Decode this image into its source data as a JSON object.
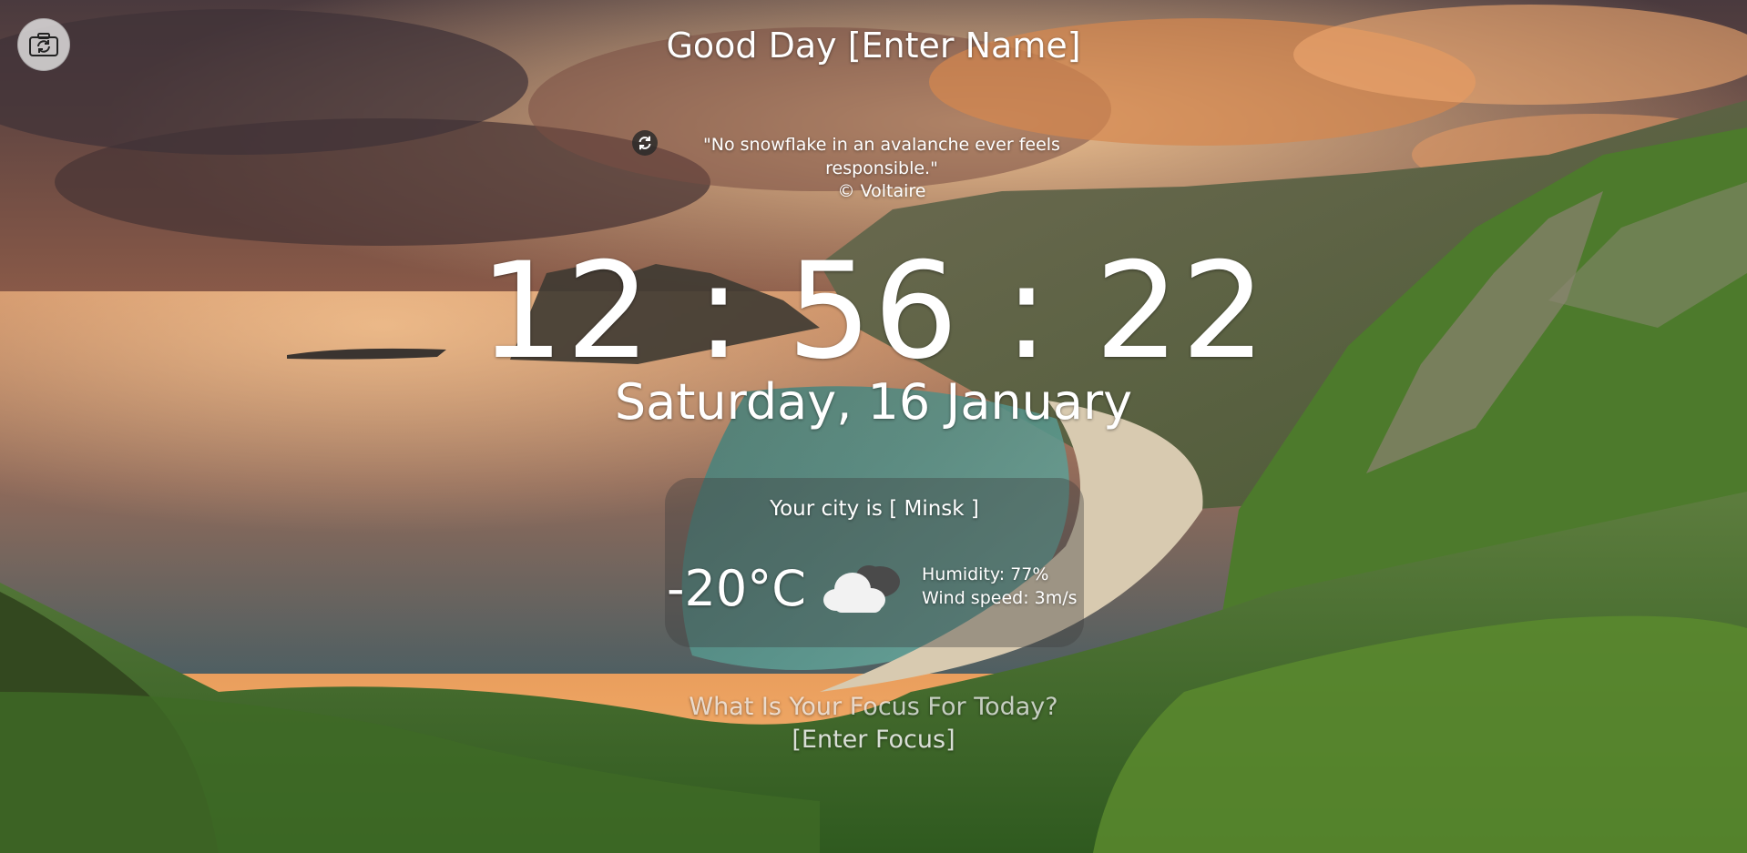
{
  "greeting": {
    "prefix": "Good Day",
    "name": "[Enter Name]"
  },
  "background_button": {
    "icon": "refresh-image-icon"
  },
  "quote": {
    "refresh_icon": "refresh-icon",
    "text": "\"No snowflake in an avalanche ever feels responsible.\"",
    "author": "© Voltaire"
  },
  "clock": {
    "time": "12 : 56 : 22"
  },
  "date": {
    "text": "Saturday, 16 January"
  },
  "weather": {
    "city_prefix": "Your city is",
    "city": "[ Minsk ]",
    "temperature": "-20°C",
    "icon": "cloudy-icon",
    "humidity": "Humidity: 77%",
    "wind": "Wind speed: 3m/s"
  },
  "focus": {
    "question": "What Is Your Focus For Today?",
    "value": "[Enter Focus]"
  }
}
